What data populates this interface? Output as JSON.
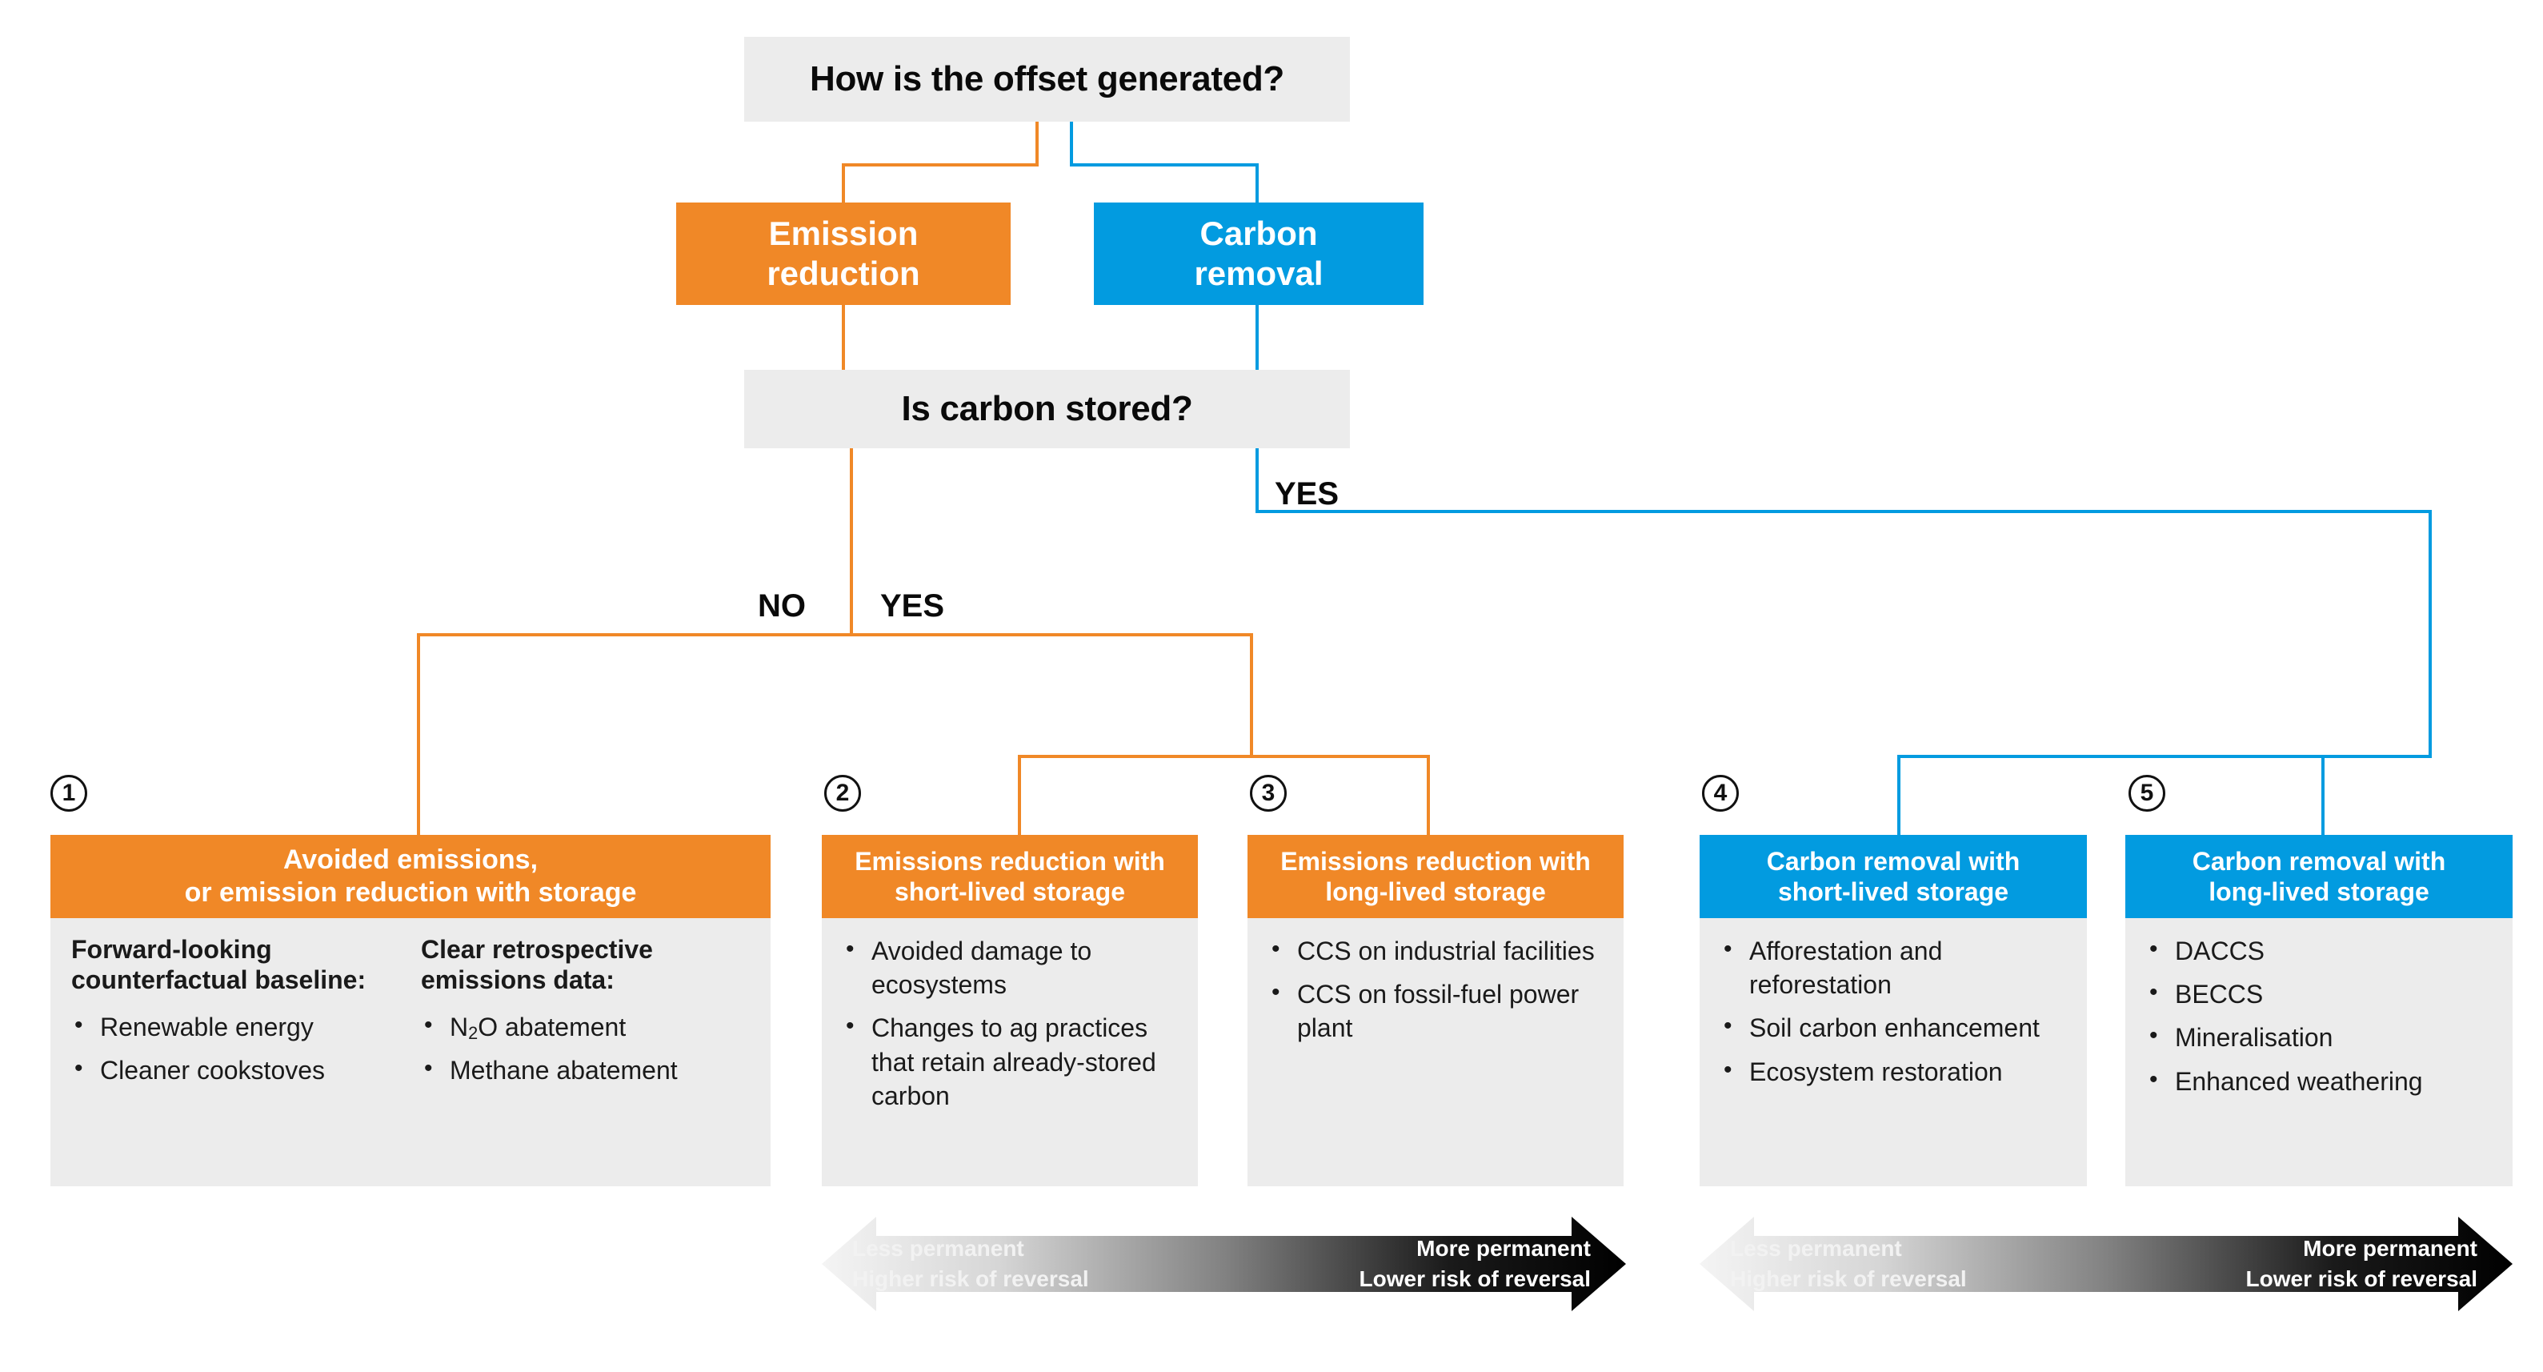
{
  "questions": {
    "offset": "How is the offset generated?",
    "stored": "Is carbon stored?"
  },
  "branches": {
    "emission": "Emission\nreduction",
    "emission_line1": "Emission",
    "emission_line2": "reduction",
    "removal_line1": "Carbon",
    "removal_line2": "removal"
  },
  "flags": {
    "yes_removal": "YES",
    "no_stored": "NO",
    "yes_stored": "YES"
  },
  "colors": {
    "orange": "#F08827",
    "blue": "#029BE0",
    "box_grey": "#ECECEC",
    "text": "#111111"
  },
  "cards": [
    {
      "number": "1",
      "accent": "orange",
      "title_line1": "Avoided emissions,",
      "title_line2": "or emission reduction with storage",
      "columns": [
        {
          "subhead": "Forward-looking counterfactual baseline:",
          "items": [
            "Renewable energy",
            "Cleaner cookstoves"
          ]
        },
        {
          "subhead": "Clear retrospective emissions data:",
          "items": [
            "N₂O abatement",
            "Methane abatement"
          ]
        }
      ]
    },
    {
      "number": "2",
      "accent": "orange",
      "title_line1": "Emissions reduction with",
      "title_line2": "short-lived storage",
      "items": [
        "Avoided damage to ecosystems",
        "Changes to ag practices that retain already-stored carbon"
      ]
    },
    {
      "number": "3",
      "accent": "orange",
      "title_line1": "Emissions reduction with",
      "title_line2": "long-lived storage",
      "items": [
        "CCS on industrial facilities",
        "CCS on fossil-fuel power plant"
      ]
    },
    {
      "number": "4",
      "accent": "blue",
      "title_line1": "Carbon removal with",
      "title_line2": "short-lived storage",
      "items": [
        "Afforestation and reforestation",
        "Soil carbon enhancement",
        "Ecosystem restoration"
      ]
    },
    {
      "number": "5",
      "accent": "blue",
      "title_line1": "Carbon removal with",
      "title_line2": "long-lived storage",
      "items": [
        "DACCS",
        "BECCS",
        "Mineralisation",
        "Enhanced weathering"
      ]
    }
  ],
  "permanence": {
    "left_line1": "Less permanent",
    "left_line2": "Higher risk of reversal",
    "right_line1": "More permanent",
    "right_line2": "Lower risk of reversal"
  }
}
